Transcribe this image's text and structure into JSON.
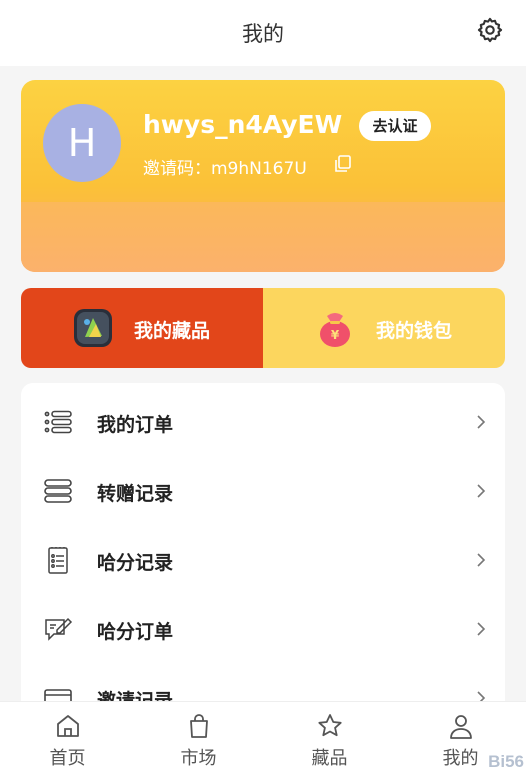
{
  "header": {
    "title": "我的",
    "settings_icon": "gear-icon"
  },
  "profile": {
    "avatar_letter": "H",
    "avatar_color": "#a8b1e3",
    "username": "hwys_n4AyEW",
    "verify_label": "去认证",
    "invite_text": "邀请码：m9hN167U",
    "copy_icon": "copy-icon"
  },
  "actions": {
    "collection_label": "我的藏品",
    "wallet_label": "我的钱包",
    "collection_color": "#e2461a",
    "wallet_color": "#fcd65e"
  },
  "menu": {
    "items": [
      {
        "label": "我的订单",
        "icon": "list-icon"
      },
      {
        "label": "转赠记录",
        "icon": "stack-icon"
      },
      {
        "label": "哈分记录",
        "icon": "notepad-icon"
      },
      {
        "label": "哈分订单",
        "icon": "edit-message-icon"
      },
      {
        "label": "邀请记录",
        "icon": "card-icon"
      }
    ]
  },
  "tabbar": {
    "tabs": [
      {
        "label": "首页",
        "icon": "home-icon"
      },
      {
        "label": "市场",
        "icon": "bag-icon"
      },
      {
        "label": "藏品",
        "icon": "star-icon"
      },
      {
        "label": "我的",
        "icon": "person-icon"
      }
    ]
  },
  "watermark": "Bi56"
}
